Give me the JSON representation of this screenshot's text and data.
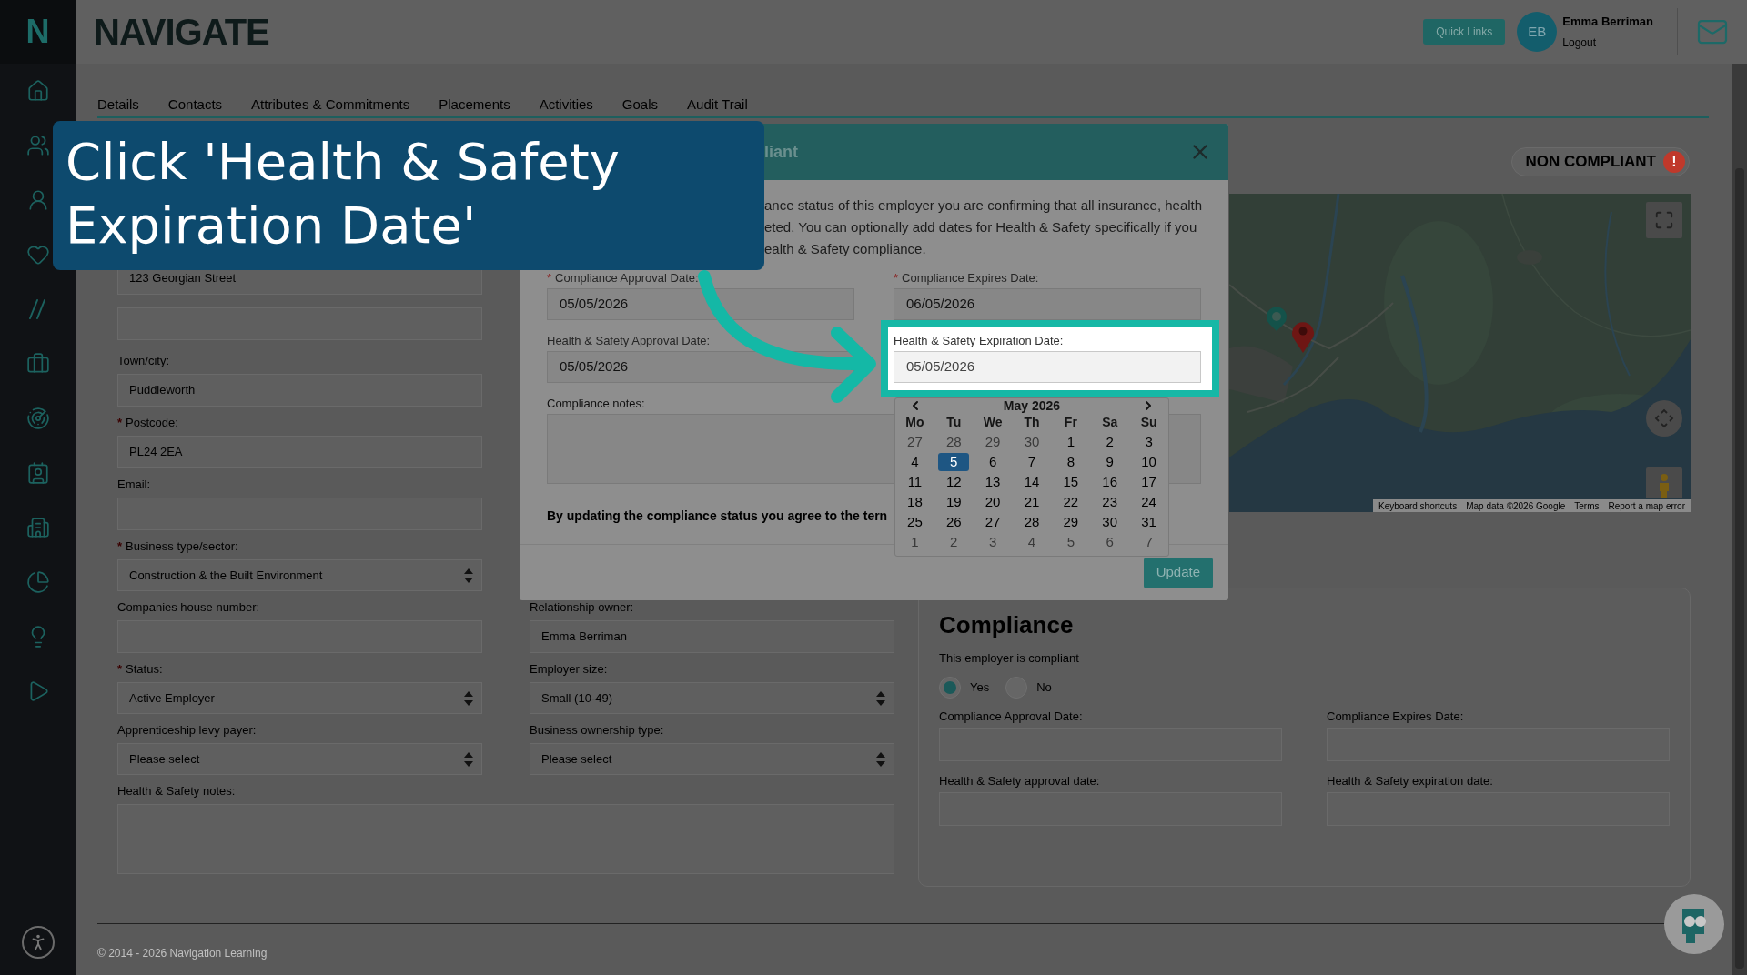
{
  "sidebar": {
    "logo": "N"
  },
  "header": {
    "logo": "NAVIGATE",
    "quick_links": "Quick Links",
    "user": {
      "initials": "EB",
      "name": "Emma Berriman",
      "logout": "Logout"
    }
  },
  "tabs": [
    {
      "label": "Details",
      "selected": false
    },
    {
      "label": "Contacts",
      "selected": false
    },
    {
      "label": "Attributes & Commitments",
      "selected": false
    },
    {
      "label": "Placements",
      "selected": false
    },
    {
      "label": "Activities",
      "selected": false
    },
    {
      "label": "Goals",
      "selected": false
    },
    {
      "label": "Audit Trail",
      "selected": false
    }
  ],
  "form": {
    "rows": [
      [
        {
          "kind": "input",
          "value": "123 Georgian Street"
        }
      ],
      [
        {
          "kind": "input"
        }
      ],
      [
        {
          "kind": "input",
          "label": "Town/city:",
          "value": "Puddleworth"
        }
      ],
      [
        {
          "kind": "input",
          "label": "Postcode:",
          "required_mark": "*",
          "value": "PL24 2EA"
        }
      ],
      [
        {
          "kind": "input",
          "label": "Email:"
        }
      ],
      [
        {
          "kind": "select",
          "label": "Business type/sector:",
          "required_mark": "*",
          "value": "Construction & the Built Environment"
        }
      ],
      [
        {
          "kind": "input",
          "label": "Companies house number:"
        },
        {
          "kind": "input",
          "label": "Relationship owner:",
          "value": "Emma Berriman"
        }
      ],
      [
        {
          "kind": "select",
          "label": "Status:",
          "required_mark": "*",
          "value": "Active Employer"
        },
        {
          "kind": "select",
          "label": "Employer size:",
          "value": "Small (10-49)"
        }
      ],
      [
        {
          "kind": "select",
          "label": "Apprenticeship levy payer:",
          "value": "Please select"
        },
        {
          "kind": "select",
          "label": "Business ownership type:",
          "value": "Please select"
        }
      ],
      [
        {
          "kind": "textarea",
          "label": "Health & Safety notes:",
          "wide": true
        }
      ]
    ]
  },
  "status_badge": {
    "label": "NON COMPLIANT",
    "icon": "!"
  },
  "map": {
    "kind": "picture",
    "attribution": [
      "Keyboard shortcuts",
      "Map data ©2026 Google",
      "Terms",
      "Report a map error"
    ]
  },
  "compliance_card": {
    "title": "Compliance",
    "question": "This employer is compliant",
    "options": [
      {
        "label": "Yes",
        "selected": true
      },
      {
        "label": "No",
        "selected": false
      }
    ],
    "fields": [
      "Compliance Approval Date:",
      "Compliance Expires Date:",
      "Health & Safety approval date:",
      "Health & Safety expiration date:"
    ]
  },
  "footer": {
    "copyright": "© 2014 - 2026 Navigation Learning"
  },
  "modal": {
    "title": "liant",
    "intro_lines": [
      "ance status of this employer you are confirming that all insurance, health",
      "eted. You can optionally add dates for Health & Safety specifically if you",
      "ealth & Safety compliance."
    ],
    "fields": [
      {
        "label": "Compliance Approval Date:",
        "required_mark": "*",
        "value": "05/05/2026",
        "highlighted": false
      },
      {
        "label": "Compliance Expires Date:",
        "required_mark": "*",
        "value": "06/05/2026",
        "highlighted": false
      },
      {
        "label": "Health & Safety Approval Date:",
        "value": "05/05/2026",
        "highlighted": false
      },
      {
        "label": "Health & Safety Expiration Date:",
        "value": "05/05/2026",
        "highlighted": true
      }
    ],
    "notes_label": "Compliance notes:",
    "agreement": "By updating the compliance status you agree to the tern",
    "button": "Update"
  },
  "datepicker": {
    "month": "May 2026",
    "weekdays": [
      "Mo",
      "Tu",
      "We",
      "Th",
      "Fr",
      "Sa",
      "Su"
    ],
    "weeks": [
      [
        {
          "day": "27",
          "muted": true,
          "selected": false
        },
        {
          "day": "28",
          "muted": true,
          "selected": false
        },
        {
          "day": "29",
          "muted": true,
          "selected": false
        },
        {
          "day": "30",
          "muted": true,
          "selected": false
        },
        {
          "day": "1",
          "muted": false,
          "selected": false
        },
        {
          "day": "2",
          "muted": false,
          "selected": false
        },
        {
          "day": "3",
          "muted": false,
          "selected": false
        }
      ],
      [
        {
          "day": "4",
          "muted": false,
          "selected": false
        },
        {
          "day": "5",
          "muted": false,
          "selected": true
        },
        {
          "day": "6",
          "muted": false,
          "selected": false
        },
        {
          "day": "7",
          "muted": false,
          "selected": false
        },
        {
          "day": "8",
          "muted": false,
          "selected": false
        },
        {
          "day": "9",
          "muted": false,
          "selected": false
        },
        {
          "day": "10",
          "muted": false,
          "selected": false
        }
      ],
      [
        {
          "day": "11",
          "muted": false,
          "selected": false
        },
        {
          "day": "12",
          "muted": false,
          "selected": false
        },
        {
          "day": "13",
          "muted": false,
          "selected": false
        },
        {
          "day": "14",
          "muted": false,
          "selected": false
        },
        {
          "day": "15",
          "muted": false,
          "selected": false
        },
        {
          "day": "16",
          "muted": false,
          "selected": false
        },
        {
          "day": "17",
          "muted": false,
          "selected": false
        }
      ],
      [
        {
          "day": "18",
          "muted": false,
          "selected": false
        },
        {
          "day": "19",
          "muted": false,
          "selected": false
        },
        {
          "day": "20",
          "muted": false,
          "selected": false
        },
        {
          "day": "21",
          "muted": false,
          "selected": false
        },
        {
          "day": "22",
          "muted": false,
          "selected": false
        },
        {
          "day": "23",
          "muted": false,
          "selected": false
        },
        {
          "day": "24",
          "muted": false,
          "selected": false
        }
      ],
      [
        {
          "day": "25",
          "muted": false,
          "selected": false
        },
        {
          "day": "26",
          "muted": false,
          "selected": false
        },
        {
          "day": "27",
          "muted": false,
          "selected": false
        },
        {
          "day": "28",
          "muted": false,
          "selected": false
        },
        {
          "day": "29",
          "muted": false,
          "selected": false
        },
        {
          "day": "30",
          "muted": false,
          "selected": false
        },
        {
          "day": "31",
          "muted": false,
          "selected": false
        }
      ],
      [
        {
          "day": "1",
          "muted": true,
          "selected": false
        },
        {
          "day": "2",
          "muted": true,
          "selected": false
        },
        {
          "day": "3",
          "muted": true,
          "selected": false
        },
        {
          "day": "4",
          "muted": true,
          "selected": false
        },
        {
          "day": "5",
          "muted": true,
          "selected": false
        },
        {
          "day": "6",
          "muted": true,
          "selected": false
        },
        {
          "day": "7",
          "muted": true,
          "selected": false
        }
      ]
    ]
  },
  "callout": {
    "text": "Click 'Health & Safety Expiration Date'"
  }
}
